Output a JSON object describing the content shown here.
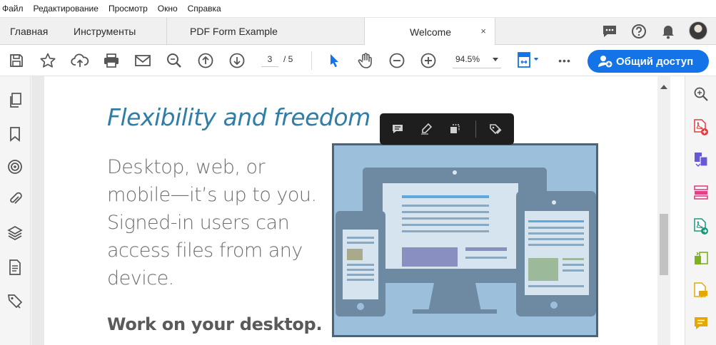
{
  "menu": [
    "Файл",
    "Редактирование",
    "Просмотр",
    "Окно",
    "Справка"
  ],
  "tabs": {
    "home": "Главная",
    "tools": "Инструменты",
    "documents": [
      "PDF Form Example",
      "Welcome"
    ],
    "active_close": "×"
  },
  "toolbar": {
    "current_page": "3",
    "page_total": "/ 5",
    "zoom": "94.5%",
    "share_label": "Общий доступ",
    "more": "•••"
  },
  "document": {
    "heading": "Flexibility and freedom",
    "body": "Desktop, web, or mobile—it’s up to you. Signed-in users can access files from any device.",
    "subheading": "Work on your desktop.",
    "faint": "..."
  },
  "colors": {
    "accent": "#1473e6",
    "heading": "#2f7ea8",
    "illustration_bg": "#9cc0dc"
  },
  "icons": {
    "left_rail": [
      "pages-icon",
      "bookmark-icon",
      "target-icon",
      "attachment-icon",
      "layers-icon",
      "document-icon",
      "tag-icon"
    ],
    "right_rail": [
      "zoom-panel-icon",
      "create-pdf-icon",
      "combine-files-icon",
      "organize-pages-icon",
      "export-pdf-icon",
      "edit-pdf-icon",
      "comment-file-icon",
      "comment-icon"
    ]
  }
}
